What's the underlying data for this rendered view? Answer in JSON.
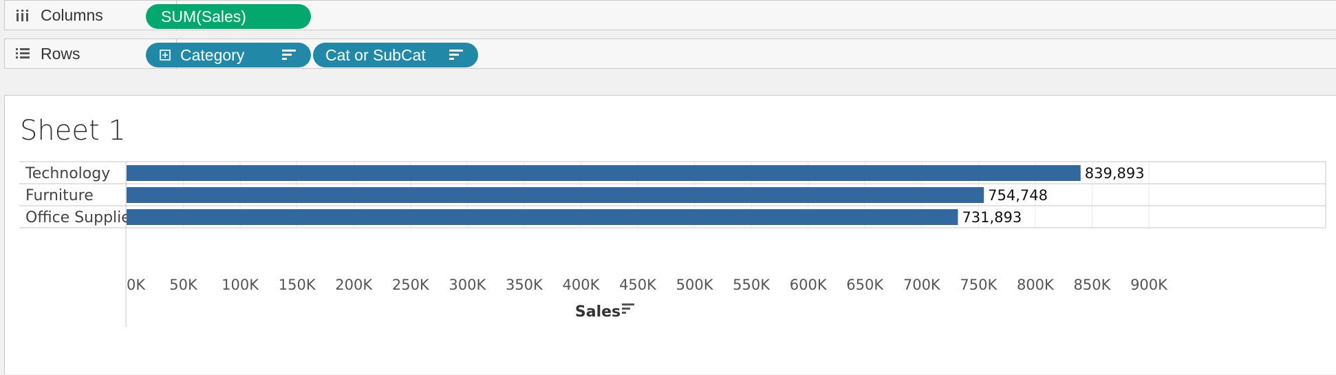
{
  "columns_shelf": {
    "label": "Columns",
    "icon": "columns-icon",
    "pills": [
      {
        "label": "SUM(Sales)",
        "kind": "measure",
        "color": "#03a86e"
      }
    ]
  },
  "rows_shelf": {
    "label": "Rows",
    "icon": "rows-icon",
    "pills": [
      {
        "label": "Category",
        "kind": "dimension",
        "color": "#2188a8",
        "icons": [
          "expand-icon",
          "sort-icon"
        ]
      },
      {
        "label": "Cat or SubCat",
        "kind": "dimension",
        "color": "#2188a8",
        "icons": [
          "sort-icon"
        ]
      }
    ]
  },
  "sheet": {
    "title": "Sheet 1"
  },
  "chart_data": {
    "type": "bar",
    "orientation": "horizontal",
    "categories": [
      "Technology",
      "Furniture",
      "Office Supplies"
    ],
    "values": [
      839893,
      754748,
      731893
    ],
    "value_labels": [
      "839,893",
      "754,748",
      "731,893"
    ],
    "xlabel": "Sales",
    "xlabel_icon": "sort-icon",
    "xlim": [
      0,
      900000
    ],
    "xticks": [
      0,
      50000,
      100000,
      150000,
      200000,
      250000,
      300000,
      350000,
      400000,
      450000,
      500000,
      550000,
      600000,
      650000,
      700000,
      750000,
      800000,
      850000,
      900000
    ],
    "xtick_labels": [
      "0K",
      "50K",
      "100K",
      "150K",
      "200K",
      "250K",
      "300K",
      "350K",
      "400K",
      "450K",
      "500K",
      "550K",
      "600K",
      "650K",
      "700K",
      "750K",
      "800K",
      "850K",
      "900K"
    ],
    "bar_color": "#32689e",
    "grid": true
  }
}
